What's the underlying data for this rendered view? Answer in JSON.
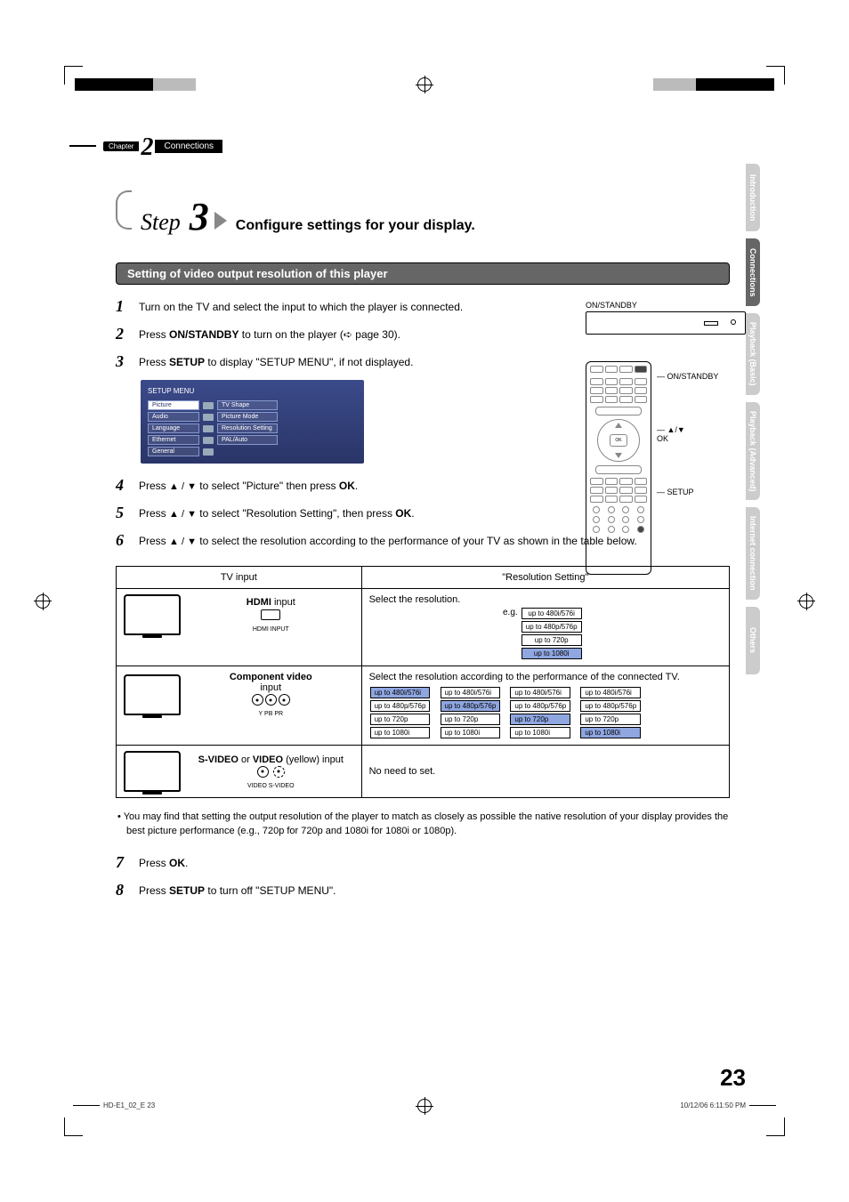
{
  "regmarks": true,
  "header": {
    "chapter_label": "Chapter",
    "chapter_num": "2",
    "chapter_title": "Connections"
  },
  "tabs": [
    "Introduction",
    "Connections",
    "Playback (Basic)",
    "Playback (Advanced)",
    "Internet connection",
    "Others"
  ],
  "active_tab_index": 1,
  "step": {
    "word": "Step",
    "num": "3",
    "title": "Configure settings for your display."
  },
  "section_title": "Setting of video output resolution of this player",
  "steps_a": [
    {
      "n": "1",
      "t": "Turn on the TV and select the input to which the player is connected."
    },
    {
      "n": "2",
      "t_pre": "Press ",
      "b1": "ON/STANDBY",
      "t_mid": " to turn on the player (",
      "icon": "➪",
      "t_post": " page 30)."
    },
    {
      "n": "3",
      "t_pre": "Press ",
      "b1": "SETUP",
      "t_post": " to display \"SETUP MENU\", if not displayed."
    }
  ],
  "osd": {
    "title": "SETUP MENU",
    "left": [
      "Picture",
      "Audio",
      "Language",
      "Ethernet",
      "General"
    ],
    "right": [
      "TV Shape",
      "Picture Mode",
      "Resolution Setting",
      "PAL/Auto"
    ]
  },
  "steps_b": [
    {
      "n": "4",
      "t_pre": "Press ",
      "arr": "▲ / ▼",
      "t_mid": " to select \"Picture\" then press ",
      "b1": "OK",
      "t_post": "."
    },
    {
      "n": "5",
      "t_pre": "Press ",
      "arr": "▲ / ▼",
      "t_mid": " to select \"Resolution Setting\", then press ",
      "b1": "OK",
      "t_post": "."
    },
    {
      "n": "6",
      "t_pre": "Press ",
      "arr": "▲ / ▼",
      "t_post": " to select the resolution according to the performance of your TV as shown in the table below."
    }
  ],
  "diagram": {
    "top_label": "ON/STANDBY",
    "callouts": [
      "ON/STANDBY",
      "▲/▼\nOK",
      "SETUP"
    ],
    "ok": "OK"
  },
  "table": {
    "head": [
      "TV input",
      "\"Resolution Setting\""
    ],
    "rows": [
      {
        "input_title": "HDMI",
        "input_suffix": " input",
        "sub": "HDMI INPUT",
        "kind": "hdmi",
        "right_pre": "Select the resolution.",
        "right_eg": "e.g.",
        "pill_cols": [
          [
            "up to 480i/576i",
            "up to 480p/576p",
            "up to 720p",
            "up to 1080i"
          ]
        ],
        "hl": [
          [
            3
          ]
        ]
      },
      {
        "input_title": "Component video",
        "input_suffix": "\ninput",
        "sub": "Y   PB   PR",
        "kind": "component",
        "right_pre": "Select the resolution according to the performance of the connected TV.",
        "pill_cols": [
          [
            "up to 480i/576i",
            "up to 480p/576p",
            "up to 720p",
            "up to 1080i"
          ],
          [
            "up to 480i/576i",
            "up to 480p/576p",
            "up to 720p",
            "up to 1080i"
          ],
          [
            "up to 480i/576i",
            "up to 480p/576p",
            "up to 720p",
            "up to 1080i"
          ],
          [
            "up to 480i/576i",
            "up to 480p/576p",
            "up to 720p",
            "up to 1080i"
          ]
        ],
        "hl": [
          [
            0
          ],
          [
            1
          ],
          [
            2
          ],
          [
            3
          ]
        ]
      },
      {
        "input_title": "S-VIDEO",
        "input_mid": " or\n",
        "input_title2": "VIDEO",
        "input_suffix": " (yellow) input",
        "sub": "VIDEO   S-VIDEO",
        "kind": "svideo",
        "right_pre": "No need to set."
      }
    ]
  },
  "note": "• You may find that setting the output resolution of the player to match as closely as possible the native resolution of your display provides the best picture performance (e.g., 720p for 720p and 1080i for 1080i or 1080p).",
  "steps_c": [
    {
      "n": "7",
      "t_pre": "Press ",
      "b1": "OK",
      "t_post": "."
    },
    {
      "n": "8",
      "t_pre": "Press ",
      "b1": "SETUP",
      "t_post": " to turn off \"SETUP MENU\"."
    }
  ],
  "page_number": "23",
  "footer_left": "HD-E1_02_E   23",
  "footer_right": "10/12/06   6:11:50 PM"
}
